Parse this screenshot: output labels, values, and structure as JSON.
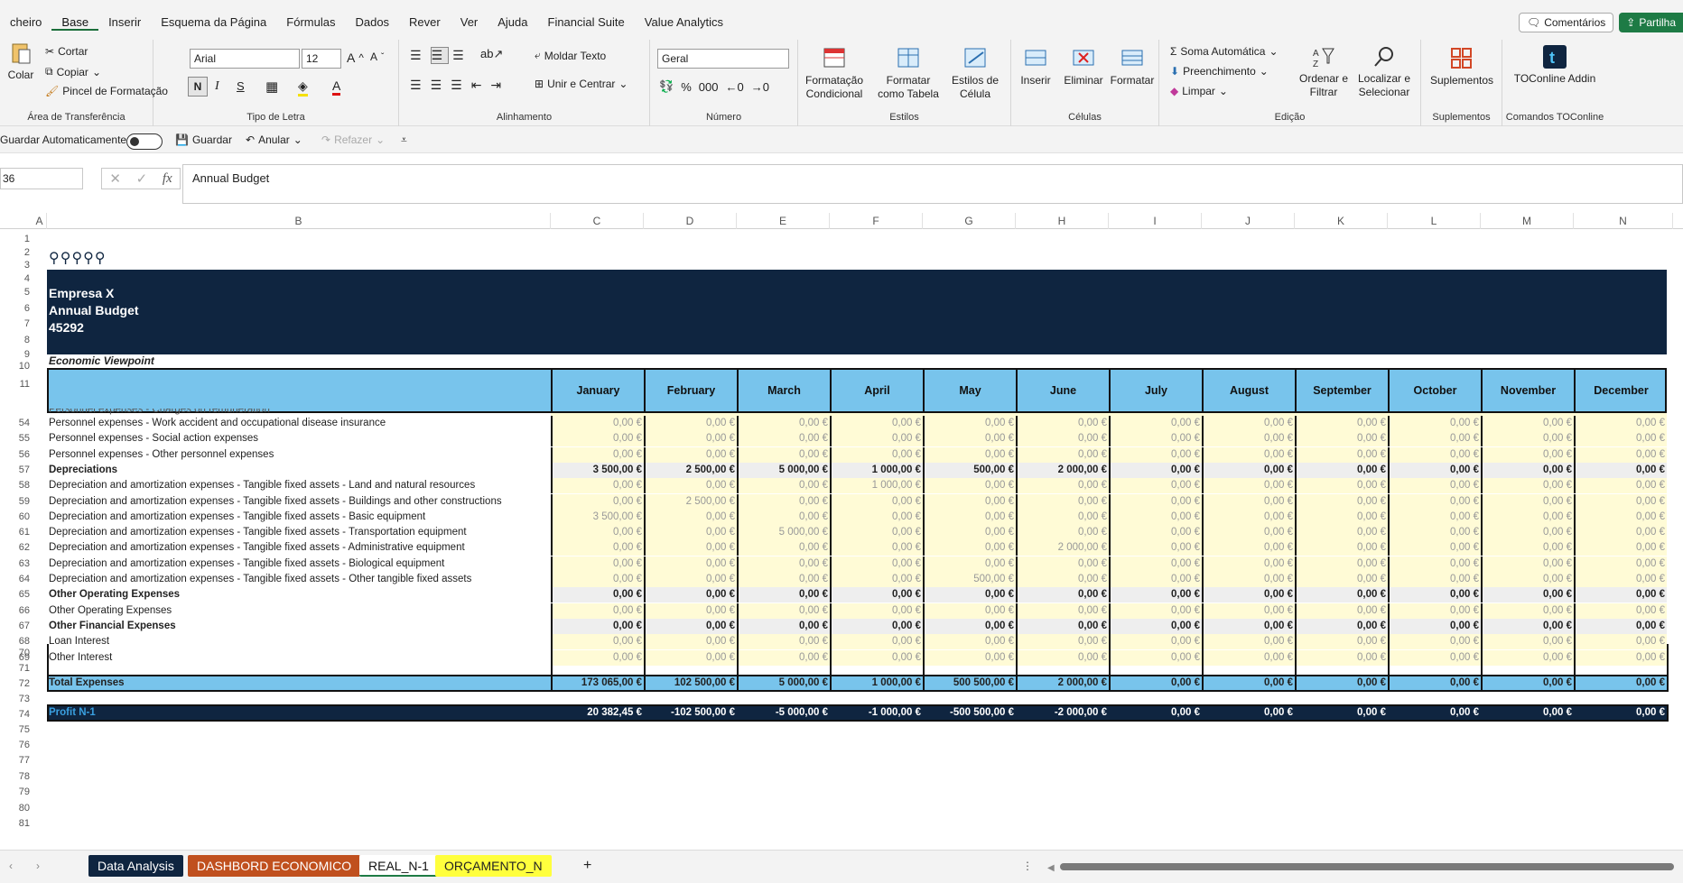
{
  "menu": {
    "tabs": [
      "cheiro",
      "Base",
      "Inserir",
      "Esquema da Página",
      "Fórmulas",
      "Dados",
      "Rever",
      "Ver",
      "Ajuda",
      "Financial Suite",
      "Value Analytics"
    ],
    "comments_label": "Comentários",
    "share_label": "Partilha"
  },
  "ribbon": {
    "clipboard": {
      "paste": "Colar",
      "cut": "Cortar",
      "copy": "Copiar",
      "format_painter": "Pincel de Formatação",
      "label": "Área de Transferência"
    },
    "font": {
      "name": "Arial",
      "size": "12",
      "bold": "N",
      "italic": "I",
      "underline": "S",
      "label": "Tipo de Letra"
    },
    "alignment": {
      "wrap": "Moldar Texto",
      "merge": "Unir e Centrar",
      "label": "Alinhamento"
    },
    "number": {
      "format": "Geral",
      "label": "Número"
    },
    "styles": {
      "conditional": "Formatação Condicional",
      "table": "Formatar como Tabela",
      "cell": "Estilos de Célula",
      "label": "Estilos"
    },
    "cells": {
      "insert": "Inserir",
      "delete": "Eliminar",
      "format": "Formatar",
      "label": "Células"
    },
    "editing": {
      "autosum": "Soma Automática",
      "fill": "Preenchimento",
      "clear": "Limpar",
      "sort": "Ordenar e Filtrar",
      "find": "Localizar e Selecionar",
      "label": "Edição"
    },
    "addins": {
      "label_btn": "Suplementos",
      "label": "Suplementos"
    },
    "toconline": {
      "btn": "TOConline Addin",
      "label": "Comandos TOConline"
    }
  },
  "qat": {
    "autosave": "Guardar Automaticamente",
    "save": "Guardar",
    "undo": "Anular",
    "redo": "Refazer"
  },
  "formula": {
    "namebox": "36",
    "fx": "fx",
    "content": "Annual Budget"
  },
  "columns": [
    "A",
    "B",
    "C",
    "D",
    "E",
    "F",
    "G",
    "H",
    "I",
    "J",
    "K",
    "L",
    "M",
    "N"
  ],
  "banner": {
    "company": "Empresa X",
    "title": "Annual Budget",
    "code": "45292",
    "subtitle": "Economic Viewpoint"
  },
  "months": [
    "January",
    "February",
    "March",
    "April",
    "May",
    "June",
    "July",
    "August",
    "September",
    "October",
    "November",
    "December"
  ],
  "rows": [
    {
      "n": "54",
      "label": "Personnel expenses - Work accident and occupational disease insurance",
      "bold": false,
      "vals": [
        "0,00 €",
        "0,00 €",
        "0,00 €",
        "0,00 €",
        "0,00 €",
        "0,00 €",
        "0,00 €",
        "0,00 €",
        "0,00 €",
        "0,00 €",
        "0,00 €",
        "0,00 €"
      ]
    },
    {
      "n": "55",
      "label": "Personnel expenses - Social action expenses",
      "bold": false,
      "vals": [
        "0,00 €",
        "0,00 €",
        "0,00 €",
        "0,00 €",
        "0,00 €",
        "0,00 €",
        "0,00 €",
        "0,00 €",
        "0,00 €",
        "0,00 €",
        "0,00 €",
        "0,00 €"
      ]
    },
    {
      "n": "56",
      "label": "Personnel expenses - Other personnel expenses",
      "bold": false,
      "vals": [
        "0,00 €",
        "0,00 €",
        "0,00 €",
        "0,00 €",
        "0,00 €",
        "0,00 €",
        "0,00 €",
        "0,00 €",
        "0,00 €",
        "0,00 €",
        "0,00 €",
        "0,00 €"
      ]
    },
    {
      "n": "57",
      "label": "Depreciations",
      "bold": true,
      "vals": [
        "3 500,00 €",
        "2 500,00 €",
        "5 000,00 €",
        "1 000,00 €",
        "500,00 €",
        "2 000,00 €",
        "0,00 €",
        "0,00 €",
        "0,00 €",
        "0,00 €",
        "0,00 €",
        "0,00 €"
      ]
    },
    {
      "n": "58",
      "label": "Depreciation and amortization expenses - Tangible fixed assets - Land and natural resources",
      "bold": false,
      "vals": [
        "0,00 €",
        "0,00 €",
        "0,00 €",
        "1 000,00 €",
        "0,00 €",
        "0,00 €",
        "0,00 €",
        "0,00 €",
        "0,00 €",
        "0,00 €",
        "0,00 €",
        "0,00 €"
      ]
    },
    {
      "n": "59",
      "label": "Depreciation and amortization expenses - Tangible fixed assets - Buildings and other constructions",
      "bold": false,
      "vals": [
        "0,00 €",
        "2 500,00 €",
        "0,00 €",
        "0,00 €",
        "0,00 €",
        "0,00 €",
        "0,00 €",
        "0,00 €",
        "0,00 €",
        "0,00 €",
        "0,00 €",
        "0,00 €"
      ]
    },
    {
      "n": "60",
      "label": "Depreciation and amortization expenses - Tangible fixed assets - Basic equipment",
      "bold": false,
      "vals": [
        "3 500,00 €",
        "0,00 €",
        "0,00 €",
        "0,00 €",
        "0,00 €",
        "0,00 €",
        "0,00 €",
        "0,00 €",
        "0,00 €",
        "0,00 €",
        "0,00 €",
        "0,00 €"
      ]
    },
    {
      "n": "61",
      "label": "Depreciation and amortization expenses - Tangible fixed assets - Transportation equipment",
      "bold": false,
      "vals": [
        "0,00 €",
        "0,00 €",
        "5 000,00 €",
        "0,00 €",
        "0,00 €",
        "0,00 €",
        "0,00 €",
        "0,00 €",
        "0,00 €",
        "0,00 €",
        "0,00 €",
        "0,00 €"
      ]
    },
    {
      "n": "62",
      "label": "Depreciation and amortization expenses - Tangible fixed assets - Administrative equipment",
      "bold": false,
      "vals": [
        "0,00 €",
        "0,00 €",
        "0,00 €",
        "0,00 €",
        "0,00 €",
        "2 000,00 €",
        "0,00 €",
        "0,00 €",
        "0,00 €",
        "0,00 €",
        "0,00 €",
        "0,00 €"
      ]
    },
    {
      "n": "63",
      "label": "Depreciation and amortization expenses - Tangible fixed assets - Biological equipment",
      "bold": false,
      "vals": [
        "0,00 €",
        "0,00 €",
        "0,00 €",
        "0,00 €",
        "0,00 €",
        "0,00 €",
        "0,00 €",
        "0,00 €",
        "0,00 €",
        "0,00 €",
        "0,00 €",
        "0,00 €"
      ]
    },
    {
      "n": "64",
      "label": "Depreciation and amortization expenses - Tangible fixed assets - Other tangible fixed assets",
      "bold": false,
      "vals": [
        "0,00 €",
        "0,00 €",
        "0,00 €",
        "0,00 €",
        "500,00 €",
        "0,00 €",
        "0,00 €",
        "0,00 €",
        "0,00 €",
        "0,00 €",
        "0,00 €",
        "0,00 €"
      ]
    },
    {
      "n": "65",
      "label": "Other Operating Expenses",
      "bold": true,
      "vals": [
        "0,00 €",
        "0,00 €",
        "0,00 €",
        "0,00 €",
        "0,00 €",
        "0,00 €",
        "0,00 €",
        "0,00 €",
        "0,00 €",
        "0,00 €",
        "0,00 €",
        "0,00 €"
      ]
    },
    {
      "n": "66",
      "label": "Other Operating Expenses",
      "bold": false,
      "vals": [
        "0,00 €",
        "0,00 €",
        "0,00 €",
        "0,00 €",
        "0,00 €",
        "0,00 €",
        "0,00 €",
        "0,00 €",
        "0,00 €",
        "0,00 €",
        "0,00 €",
        "0,00 €"
      ]
    },
    {
      "n": "67",
      "label": "Other Financial Expenses",
      "bold": true,
      "vals": [
        "0,00 €",
        "0,00 €",
        "0,00 €",
        "0,00 €",
        "0,00 €",
        "0,00 €",
        "0,00 €",
        "0,00 €",
        "0,00 €",
        "0,00 €",
        "0,00 €",
        "0,00 €"
      ]
    },
    {
      "n": "68",
      "label": "Loan Interest",
      "bold": false,
      "vals": [
        "0,00 €",
        "0,00 €",
        "0,00 €",
        "0,00 €",
        "0,00 €",
        "0,00 €",
        "0,00 €",
        "0,00 €",
        "0,00 €",
        "0,00 €",
        "0,00 €",
        "0,00 €"
      ]
    },
    {
      "n": "69",
      "label": "Other Interest",
      "bold": false,
      "vals": [
        "0,00 €",
        "0,00 €",
        "0,00 €",
        "0,00 €",
        "0,00 €",
        "0,00 €",
        "0,00 €",
        "0,00 €",
        "0,00 €",
        "0,00 €",
        "0,00 €",
        "0,00 €"
      ]
    }
  ],
  "partial_row_label": "Personnel expenses - Charges on remuneration",
  "total": {
    "n": "72",
    "label": "Total Expenses",
    "vals": [
      "173 065,00 €",
      "102 500,00 €",
      "5 000,00 €",
      "1 000,00 €",
      "500 500,00 €",
      "2 000,00 €",
      "0,00 €",
      "0,00 €",
      "0,00 €",
      "0,00 €",
      "0,00 €",
      "0,00 €"
    ]
  },
  "profit": {
    "n": "74",
    "label": "Profit N-1",
    "vals": [
      "20 382,45 €",
      "-102 500,00 €",
      "-5 000,00 €",
      "-1 000,00 €",
      "-500 500,00 €",
      "-2 000,00 €",
      "0,00 €",
      "0,00 €",
      "0,00 €",
      "0,00 €",
      "0,00 €",
      "0,00 €"
    ]
  },
  "top_rows": [
    "1",
    "2",
    "3",
    "4",
    "5",
    "6",
    "7",
    "8",
    "9",
    "10",
    "11"
  ],
  "bottom_rows": [
    "70",
    "71",
    "73",
    "75",
    "76",
    "77",
    "78",
    "79",
    "80",
    "81"
  ],
  "sheets": [
    {
      "name": "Data Analysis",
      "bg": "#0f2540",
      "fg": "#ffffff"
    },
    {
      "name": "DASHBORD ECONOMICO",
      "bg": "#c0501e",
      "fg": "#ffffff"
    },
    {
      "name": "REAL_N-1",
      "bg": "#ffffff",
      "fg": "#1e7b45"
    },
    {
      "name": "ORÇAMENTO_N",
      "bg": "#ffff3d",
      "fg": "#222222"
    }
  ],
  "colors": {
    "banner": "#0f2540",
    "header": "#78c4ec",
    "input": "#fffbd6",
    "accent": "#1e7b45"
  }
}
